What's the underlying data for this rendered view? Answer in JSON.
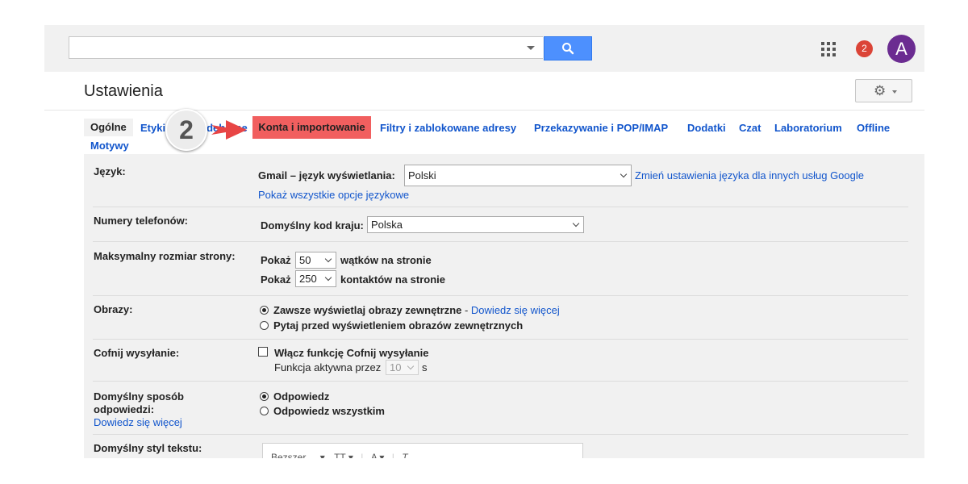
{
  "search": {
    "placeholder": "",
    "value": ""
  },
  "header": {
    "notification_count": "2",
    "avatar_letter": "A"
  },
  "page": {
    "title": "Ustawienia"
  },
  "tabs": [
    {
      "label": "Ogólne"
    },
    {
      "label": "Etykiety"
    },
    {
      "label": "Odebrane"
    },
    {
      "label": "Konta i importowanie"
    },
    {
      "label": "Filtry i zablokowane adresy"
    },
    {
      "label": "Przekazywanie i POP/IMAP"
    },
    {
      "label": "Dodatki"
    },
    {
      "label": "Czat"
    },
    {
      "label": "Laboratorium"
    },
    {
      "label": "Offline"
    },
    {
      "label": "Motywy"
    }
  ],
  "callout": {
    "step": "2"
  },
  "colors": {
    "highlight": "#f15f5f",
    "accent": "#4d90fe",
    "link": "#15c",
    "avatar": "#6b2c91",
    "badge": "#db4437"
  },
  "icons": [
    "search-icon",
    "apps-grid-icon",
    "gear-icon",
    "chevron-down-icon",
    "arrow-icon"
  ],
  "settings": {
    "language": {
      "label": "Język:",
      "field_label": "Gmail – język wyświetlania:",
      "value": "Polski",
      "change_link": "Zmień ustawienia języka dla innych usług Google",
      "show_all_link": "Pokaż wszystkie opcje językowe"
    },
    "phone": {
      "label": "Numery telefonów:",
      "field_label": "Domyślny kod kraju:",
      "value": "Polska"
    },
    "page_size": {
      "label": "Maksymalny rozmiar strony:",
      "show": "Pokaż",
      "threads_value": "50",
      "threads_suffix": "wątków na stronie",
      "contacts_value": "250",
      "contacts_suffix": "kontaktów na stronie"
    },
    "images": {
      "label": "Obrazy:",
      "option_always": "Zawsze wyświetlaj obrazy zewnętrzne",
      "separator": " - ",
      "learn_more": "Dowiedz się więcej",
      "option_ask": "Pytaj przed wyświetleniem obrazów zewnętrznych"
    },
    "undo_send": {
      "label": "Cofnij wysyłanie:",
      "checkbox_label": "Włącz funkcję Cofnij wysyłanie",
      "period_label": "Funkcja aktywna przez",
      "period_value": "10",
      "unit": "s"
    },
    "reply": {
      "label_line1": "Domyślny sposób",
      "label_line2": "odpowiedzi:",
      "learn_more": "Dowiedz się więcej",
      "option_reply": "Odpowiedz",
      "option_reply_all": "Odpowiedz wszystkim"
    },
    "text_style": {
      "label": "Domyślny styl tekstu:",
      "font_value": "Bezszer"
    }
  }
}
